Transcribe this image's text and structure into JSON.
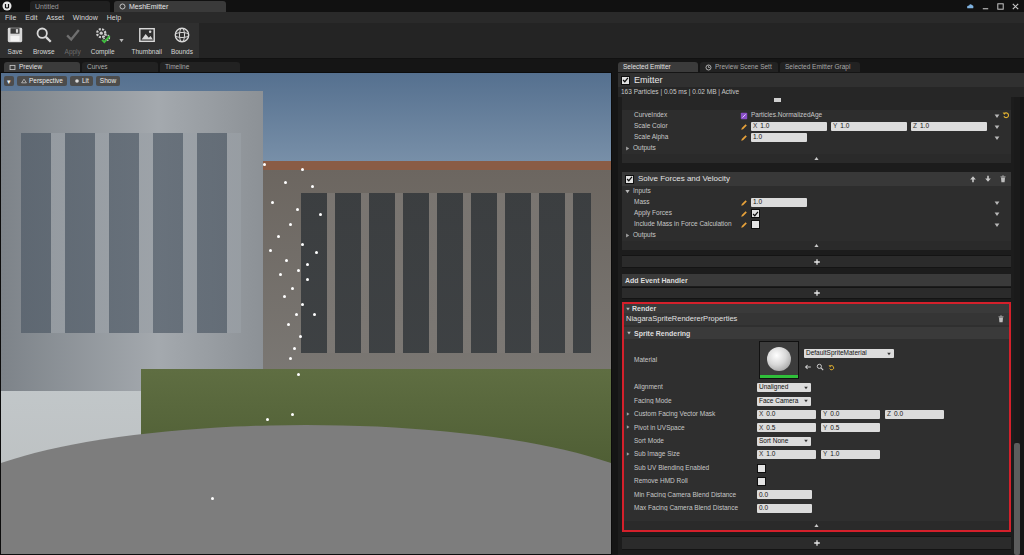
{
  "app_tabs": [
    {
      "label": "Untitled",
      "selected": false
    },
    {
      "label": "MeshEmitter",
      "selected": true
    }
  ],
  "menu": [
    "File",
    "Edit",
    "Asset",
    "Window",
    "Help"
  ],
  "toolbar": [
    {
      "label": "Save",
      "disabled": false,
      "dropdown": false
    },
    {
      "label": "Browse",
      "disabled": false,
      "dropdown": false
    },
    {
      "label": "Apply",
      "disabled": true,
      "dropdown": false
    },
    {
      "label": "Compile",
      "disabled": false,
      "dropdown": true
    },
    {
      "label": "Thumbnail",
      "disabled": false,
      "dropdown": false
    },
    {
      "label": "Bounds",
      "disabled": false,
      "dropdown": false
    }
  ],
  "preview_tabs": [
    {
      "label": "Preview",
      "selected": true
    },
    {
      "label": "Curves",
      "selected": false
    },
    {
      "label": "Timeline",
      "selected": false
    }
  ],
  "viewport": {
    "menu": "▾",
    "buttons": [
      "Perspective",
      "Lit",
      "Show"
    ]
  },
  "details_tabs": [
    {
      "label": "Selected Emitter",
      "selected": true
    },
    {
      "label": "Preview Scene Sett",
      "selected": false
    },
    {
      "label": "Selected Emitter Grapl",
      "selected": false
    }
  ],
  "emitter": {
    "title": "Emitter",
    "enabled": true,
    "stats": "163 Particles | 0.05 ms | 0.02 MB | Active"
  },
  "color_module": {
    "rows": [
      {
        "kind": "binding",
        "label": "CurveIndex",
        "value": "Particles.NormalizedAge",
        "resettable": true
      },
      {
        "kind": "vector",
        "label": "Scale Color",
        "values": [
          {
            "axis": "X",
            "value": "1.0"
          },
          {
            "axis": "Y",
            "value": "1.0"
          },
          {
            "axis": "Z",
            "value": "1.0"
          }
        ],
        "resettable": false
      },
      {
        "kind": "number",
        "label": "Scale Alpha",
        "value": "1.0",
        "resettable": false
      }
    ],
    "outputs": {
      "label": "Outputs",
      "expanded": false
    }
  },
  "solve_module": {
    "title": "Solve Forces and Velocity",
    "enabled": true,
    "inputs": {
      "label": "Inputs",
      "expanded": true
    },
    "rows": [
      {
        "kind": "number",
        "label": "Mass",
        "value": "1.0",
        "resettable": false
      },
      {
        "kind": "checkbox",
        "label": "Apply Forces",
        "checked": true,
        "resettable": false
      },
      {
        "kind": "checkbox",
        "label": "Include Mass in Force Calculation",
        "checked": false,
        "resettable": false
      }
    ],
    "outputs": {
      "label": "Outputs",
      "expanded": false
    }
  },
  "event_handler": {
    "title": "Add Event Handler"
  },
  "render": {
    "title": "Render",
    "expanded": true,
    "renderer": "NiagaraSpriteRendererProperties",
    "group": "Sprite Rendering",
    "group_expanded": true,
    "rows": [
      {
        "kind": "material",
        "label": "Material",
        "value": "DefaultSpriteMaterial",
        "expandable": false
      },
      {
        "kind": "dropdown",
        "label": "Alignment",
        "value": "Unaligned",
        "expandable": false
      },
      {
        "kind": "dropdown",
        "label": "Facing Mode",
        "value": "Face Camera",
        "expandable": false
      },
      {
        "kind": "vector",
        "label": "Custom Facing Vector Mask",
        "values": [
          {
            "axis": "X",
            "value": "0.0"
          },
          {
            "axis": "Y",
            "value": "0.0"
          },
          {
            "axis": "Z",
            "value": "0.0"
          }
        ],
        "expandable": true
      },
      {
        "kind": "vector",
        "label": "Pivot in UVSpace",
        "values": [
          {
            "axis": "X",
            "value": "0.5"
          },
          {
            "axis": "Y",
            "value": "0.5"
          }
        ],
        "expandable": true
      },
      {
        "kind": "dropdown",
        "label": "Sort Mode",
        "value": "Sort None",
        "expandable": false
      },
      {
        "kind": "vector",
        "label": "Sub Image Size",
        "values": [
          {
            "axis": "X",
            "value": "1.0"
          },
          {
            "axis": "Y",
            "value": "1.0"
          }
        ],
        "expandable": true
      },
      {
        "kind": "checkbox",
        "label": "Sub UV Blending Enabled",
        "checked": false,
        "expandable": false
      },
      {
        "kind": "checkbox",
        "label": "Remove HMD Roll",
        "checked": false,
        "expandable": false
      },
      {
        "kind": "number",
        "label": "Min Facing Camera Blend Distance",
        "value": "0.0",
        "expandable": false
      },
      {
        "kind": "number",
        "label": "Max Facing Camera Blend Distance",
        "value": "0.0",
        "expandable": false
      }
    ]
  }
}
